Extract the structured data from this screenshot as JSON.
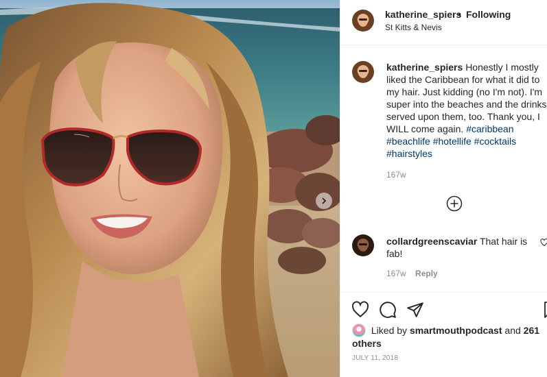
{
  "header": {
    "username": "katherine_spiers",
    "separator": "•",
    "follow_status": "Following",
    "location": "St Kitts & Nevis"
  },
  "caption": {
    "username": "katherine_spiers",
    "text": "Honestly I mostly liked the Caribbean for what it did to my hair. Just kidding (no I'm not). I'm super into the beaches and the drinks served upon them, too. Thank you, I WILL come again.",
    "hashtags": [
      "#caribbean",
      "#beachlife",
      "#hotellife",
      "#cocktails",
      "#hairstyles"
    ],
    "time": "167w"
  },
  "comments": [
    {
      "username": "collardgreenscaviar",
      "text": "That hair is fab!",
      "time": "167w",
      "reply_label": "Reply"
    }
  ],
  "likes": {
    "prefix": "Liked by",
    "user": "smartmouthpodcast",
    "conjunction": "and",
    "others": "261 others"
  },
  "post_date": "JULY 11, 2018",
  "icons": {
    "next": "chevron-right-icon",
    "load_more": "plus-circle-icon",
    "like": "heart-icon",
    "comment": "comment-bubble-icon",
    "share": "paper-plane-icon",
    "save": "bookmark-icon"
  },
  "colors": {
    "text": "#262626",
    "muted": "#8e8e8e",
    "hashtag": "#00376b",
    "border": "#efefef"
  }
}
